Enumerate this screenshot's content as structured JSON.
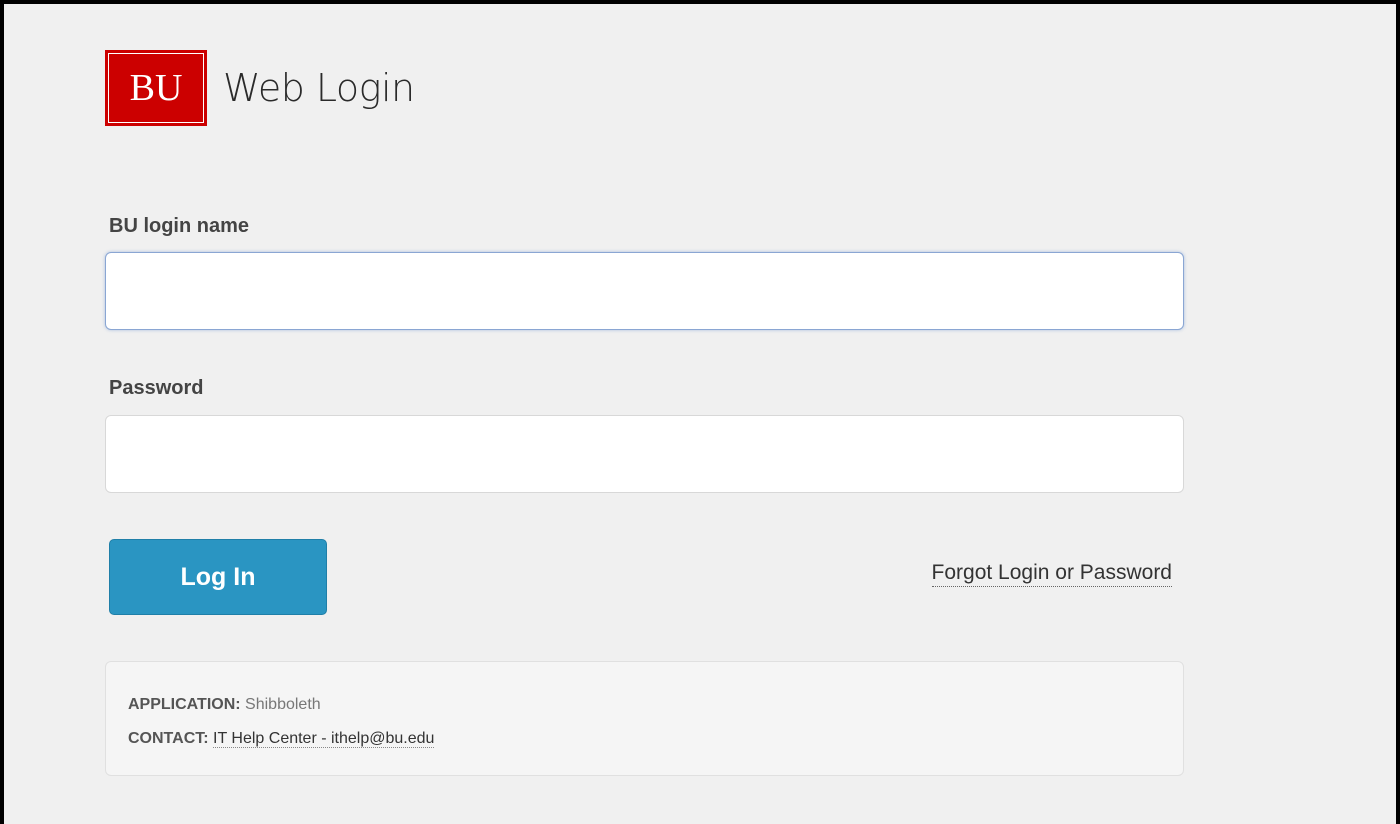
{
  "header": {
    "logo_text": "BU",
    "title": "Web Login"
  },
  "form": {
    "login_label": "BU login name",
    "login_value": "",
    "password_label": "Password",
    "password_value": "",
    "submit_label": "Log In",
    "forgot_link": "Forgot Login or Password"
  },
  "info": {
    "application_key": "APPLICATION:",
    "application_value": "Shibboleth",
    "contact_key": "CONTACT:",
    "contact_value": "IT Help Center - ithelp@bu.edu"
  },
  "colors": {
    "brand_red": "#cc0000",
    "button_blue": "#2a95c2",
    "background": "#f0f0f0"
  }
}
